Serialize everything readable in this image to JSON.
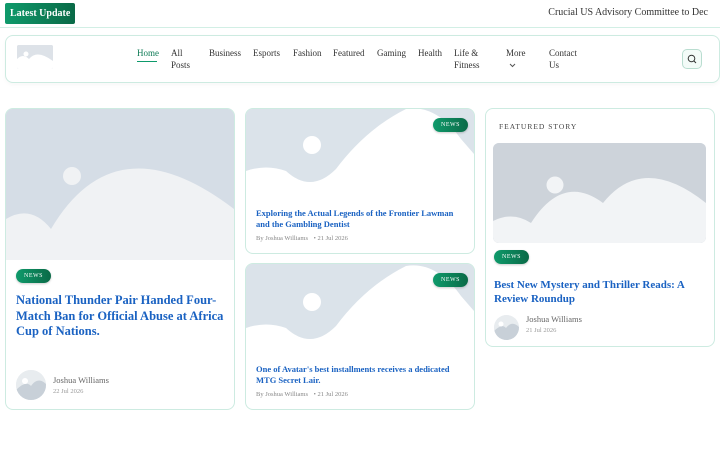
{
  "ticker": {
    "badge": "Latest Update",
    "headline": "Crucial US Advisory Committee to Dec"
  },
  "nav": {
    "items": [
      {
        "label": "Home"
      },
      {
        "label": "All Posts"
      },
      {
        "label": "Business"
      },
      {
        "label": "Esports"
      },
      {
        "label": "Fashion"
      },
      {
        "label": "Featured"
      },
      {
        "label": "Gaming"
      },
      {
        "label": "Health"
      },
      {
        "label": "Life & Fitness"
      },
      {
        "label": "More"
      },
      {
        "label": "Contact Us"
      }
    ],
    "active": "Home"
  },
  "main_story": {
    "badge": "NEWS",
    "title": "National Thunder Pair Handed Four-Match Ban for Official Abuse at Africa Cup of Nations.",
    "author": "Joshua Williams",
    "date": "22 Jul 2026"
  },
  "middle_stories": [
    {
      "badge": "NEWS",
      "title": "Exploring the Actual Legends of the Frontier Lawman and the Gambling Dentist",
      "author": "By Joshua Williams",
      "date": "• 21 Jul 2026"
    },
    {
      "badge": "NEWS",
      "title": "One of Avatar's best installments receives a dedicated MTG Secret Lair.",
      "author": "By Joshua Williams",
      "date": "• 21 Jul 2026"
    }
  ],
  "featured": {
    "label": "FEATURED STORY",
    "badge": "NEWS",
    "title": "Best New Mystery and Thriller Reads: A Review Roundup",
    "author": "Joshua Williams",
    "date": "21 Jul 2026"
  },
  "colors": {
    "accent": "#0f9a6b",
    "title_blue": "#1a62c2",
    "border": "#cdebe1"
  }
}
